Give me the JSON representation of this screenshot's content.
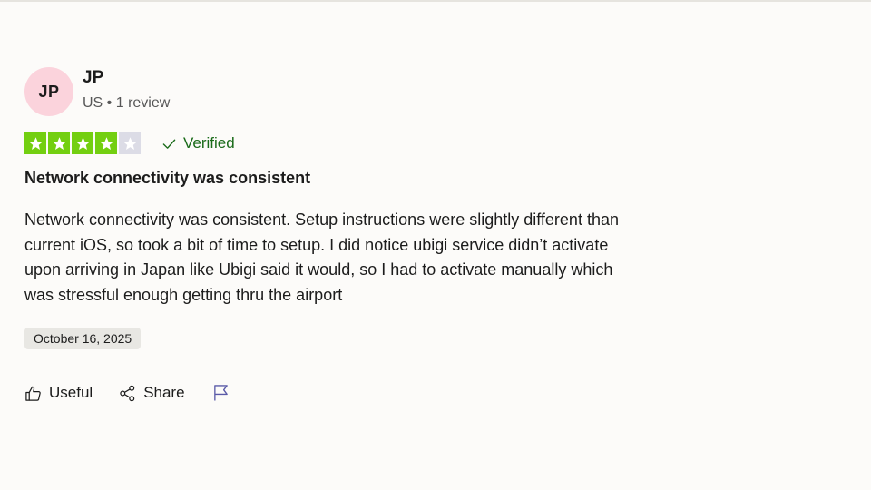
{
  "reviewer": {
    "initials": "JP",
    "name": "JP",
    "meta": "US • 1 review",
    "avatar_color": "#fbd3dc"
  },
  "rating": {
    "stars": 4,
    "max": 5,
    "on_color": "#73cf11",
    "off_color": "#dcdce6"
  },
  "verified": {
    "label": "Verified",
    "icon": "check-icon",
    "color": "#1a6b1a"
  },
  "review": {
    "title": "Network connectivity was consistent",
    "body": "Network connectivity was consistent. Setup instructions were slightly different than current iOS, so took a bit of time to setup. I did notice ubigi service didn’t activate upon arriving in Japan like Ubigi said it would, so I had to activate manually which was stressful enough getting thru the airport",
    "date": "October 16, 2025"
  },
  "actions": {
    "useful_label": "Useful",
    "useful_icon": "thumbs-up-icon",
    "share_label": "Share",
    "share_icon": "share-icon",
    "flag_icon": "flag-icon",
    "flag_color": "#5a5aa8"
  }
}
